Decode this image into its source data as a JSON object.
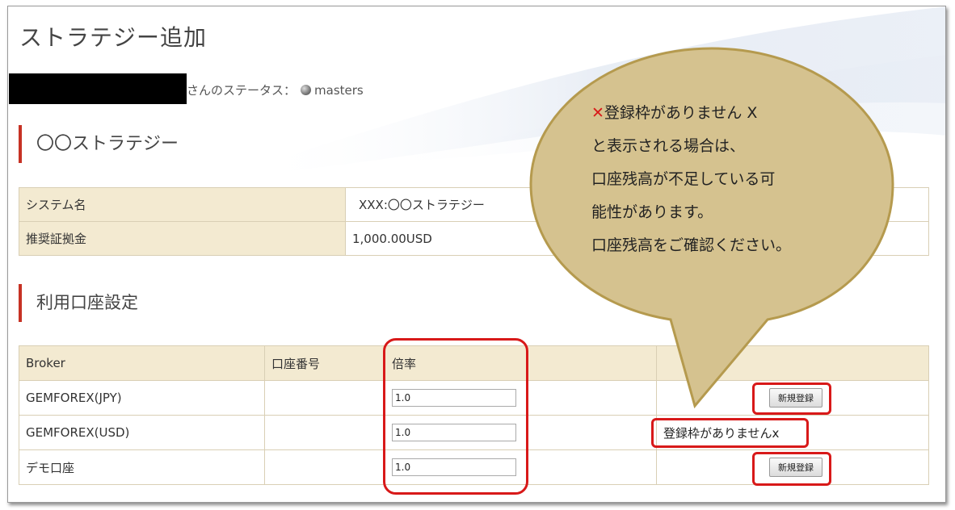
{
  "page": {
    "title": "ストラテジー追加"
  },
  "status": {
    "text": "さんのステータス：",
    "level": "masters"
  },
  "strategy": {
    "section_title": "〇〇ストラテジー",
    "rows": [
      {
        "label": "システム名",
        "value": "XXX:〇〇ストラテジー"
      },
      {
        "label": "推奨証拠金",
        "value": "1,000.00USD"
      }
    ]
  },
  "accounts": {
    "section_title": "利用口座設定",
    "headers": {
      "broker": "Broker",
      "account_no": "口座番号",
      "multiplier": "倍率",
      "action": ""
    },
    "rows": [
      {
        "broker": "GEMFOREX(JPY)",
        "account_no": "",
        "multiplier": "1.0",
        "action_type": "button",
        "action_label": "新規登録"
      },
      {
        "broker": "GEMFOREX(USD)",
        "account_no": "",
        "multiplier": "1.0",
        "action_type": "text",
        "action_label": "登録枠がありませんx"
      },
      {
        "broker": "デモ口座",
        "account_no": "",
        "multiplier": "1.0",
        "action_type": "button",
        "action_label": "新規登録"
      }
    ]
  },
  "callout": {
    "mark": "✕",
    "line1": "登録枠がありません X",
    "line2": "と表示される場合は、",
    "line3": "口座残高が不足している可",
    "line4": "能性があります。",
    "line5": "口座残高をご確認ください。"
  },
  "colors": {
    "accent_red": "#c63224",
    "highlight": "#d81919",
    "header_bg": "#f3ead1",
    "bubble_fill": "#d5c28f",
    "bubble_stroke": "#b59a4e"
  }
}
